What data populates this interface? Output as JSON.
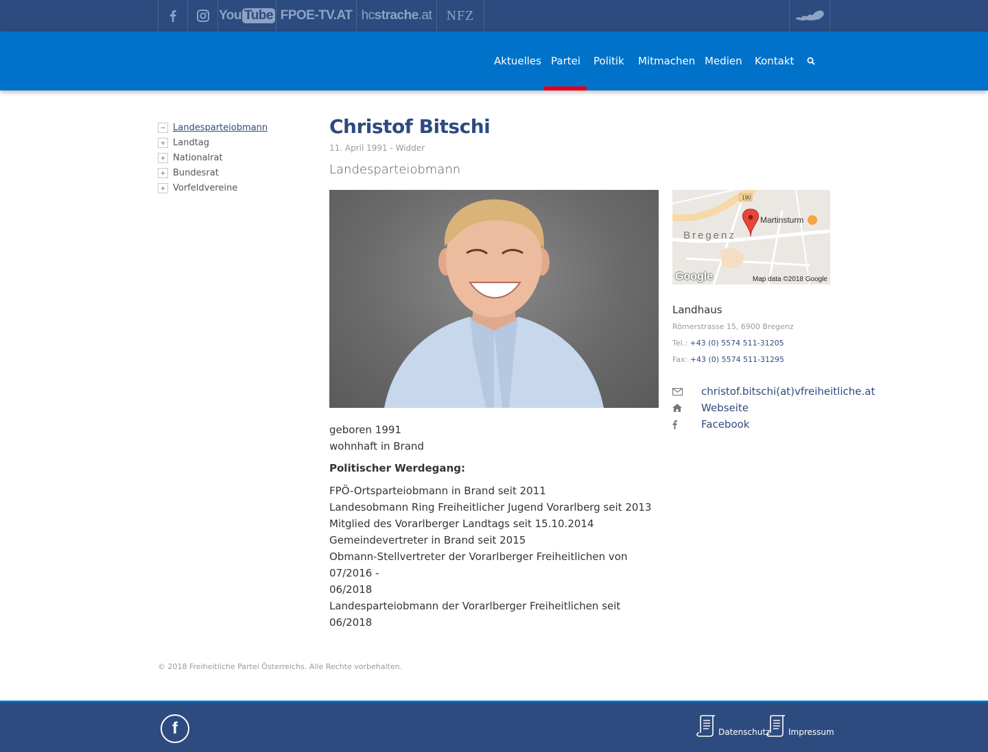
{
  "topbar": {
    "facebook_icon": "facebook-icon",
    "instagram_icon": "instagram-icon",
    "youtube": {
      "prefix": "You",
      "boxed": "Tube"
    },
    "fpoetv": "FPOE-TV.AT",
    "hcstrache": {
      "pre": "hc",
      "bold": "strache",
      "post": ".at"
    },
    "nfz": "NFZ",
    "austria_icon": "austria-map-icon"
  },
  "nav": {
    "items": [
      "Aktuelles",
      "Partei",
      "Politik",
      "Mitmachen",
      "Medien",
      "Kontakt"
    ],
    "active": "Partei",
    "search_icon": "search-icon"
  },
  "sidebar": {
    "items": [
      {
        "label": "Landesparteiobmann",
        "toggle": "−",
        "active": true
      },
      {
        "label": "Landtag",
        "toggle": "+",
        "active": false
      },
      {
        "label": "Nationalrat",
        "toggle": "+",
        "active": false
      },
      {
        "label": "Bundesrat",
        "toggle": "+",
        "active": false
      },
      {
        "label": "Vorfeldvereine",
        "toggle": "+",
        "active": false
      }
    ]
  },
  "profile": {
    "name": "Christof Bitschi",
    "dob": "11. April 1991 - Widder",
    "role": "Landesparteiobmann",
    "bio_intro": [
      "geboren 1991",
      "wohnhaft in Brand"
    ],
    "career_heading": "Politischer Werdegang:",
    "career": [
      "FPÖ-Ortsparteiobmann in Brand seit 2011",
      "Landesobmann Ring Freiheitlicher Jugend Vorarlberg seit 2013",
      "Mitglied des Vorarlberger Landtags seit 15.10.2014",
      "Gemeindevertreter in Brand seit 2015",
      "Obmann-Stellvertreter der Vorarlberger Freiheitlichen von 07/2016 -",
      "06/2018",
      "Landesparteiobmann der Vorarlberger Freiheitlichen seit 06/2018"
    ]
  },
  "map": {
    "city": "Bregenz",
    "poi": "Martinsturm",
    "road": "190",
    "google": "Google",
    "attribution": "Map data ©2018 Google"
  },
  "address": {
    "name": "Landhaus",
    "street": "Römerstrasse 15, 6900 Bregenz",
    "tel_label": "Tel.:",
    "tel": "+43 (0) 5574 511-31205",
    "fax_label": "Fax:",
    "fax": "+43 (0) 5574 511-31295"
  },
  "contacts": {
    "email": "christof.bitschi(at)vfreiheitliche.at",
    "website": "Webseite",
    "facebook": "Facebook"
  },
  "footer": {
    "copyright": "© 2018 Freiheitliche Partei Österreichs. Alle Rechte vorbehalten.",
    "facebook_glyph": "f",
    "datenschutz": "Datenschutz",
    "impressum": "Impressum"
  },
  "colors": {
    "topbar": "#2d4b7f",
    "navbar": "#0072c9",
    "active_indicator": "#e3001b",
    "heading": "#2d4b7f"
  }
}
